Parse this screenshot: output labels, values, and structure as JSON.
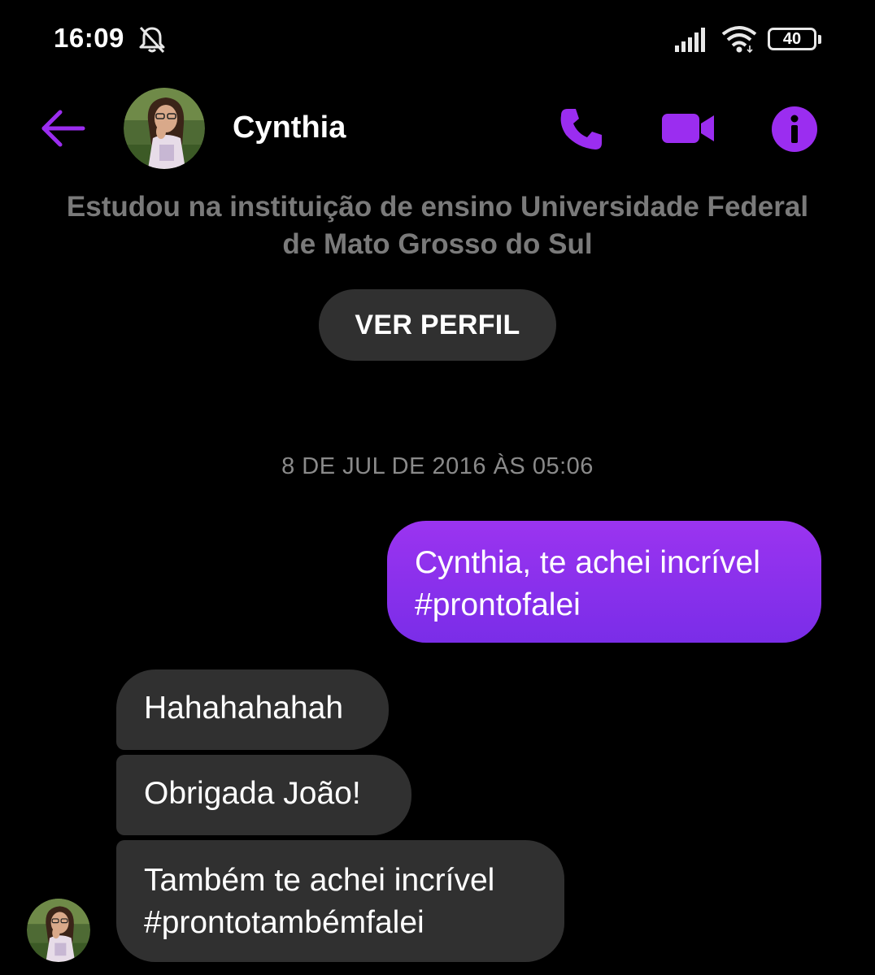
{
  "status_bar": {
    "time": "16:09",
    "battery_level": "40",
    "icons": [
      "bell-off-icon",
      "signal-icon",
      "wifi-icon",
      "battery-icon"
    ]
  },
  "header": {
    "contact_name": "Cynthia",
    "icons": [
      "back-arrow-icon",
      "phone-icon",
      "video-camera-icon",
      "info-icon"
    ],
    "accent_color": "#9b2df0"
  },
  "profile": {
    "subtitle_line1": "Estudou na instituição de ensino Universidade Federal",
    "subtitle_line2": "de Mato Grosso do Sul",
    "view_profile_label": "VER PERFIL"
  },
  "conversation": {
    "timestamp": "8 DE JUL DE 2016 ÀS 05:06",
    "messages": [
      {
        "direction": "outgoing",
        "lines": [
          "Cynthia, te achei incrível",
          "#prontofalei"
        ]
      },
      {
        "direction": "incoming",
        "lines": [
          "Hahahahahah"
        ]
      },
      {
        "direction": "incoming",
        "lines": [
          "Obrigada João!"
        ]
      },
      {
        "direction": "incoming",
        "lines": [
          "Também te achei incrível",
          "#prontotambémfalei"
        ]
      }
    ]
  },
  "colors": {
    "background": "#000000",
    "outgoing_bubble": "#8a30ee",
    "incoming_bubble": "#303030",
    "muted_text": "#7a7a7a"
  }
}
